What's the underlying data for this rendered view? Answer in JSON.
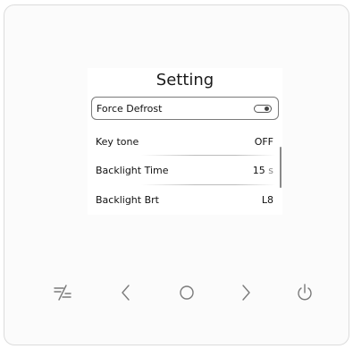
{
  "screen": {
    "title": "Setting",
    "items": [
      {
        "label": "Force Defrost",
        "control": "toggle",
        "state": "on",
        "selected": true
      },
      {
        "label": "Key tone",
        "value": "OFF"
      },
      {
        "label": "Backlight Time",
        "value": "15",
        "unit": "s"
      },
      {
        "label": "Backlight Brt",
        "value": "L8"
      }
    ]
  },
  "buttons": [
    {
      "name": "mode-button",
      "icon": "mode-slash-icon"
    },
    {
      "name": "left-button",
      "icon": "chevron-left-icon"
    },
    {
      "name": "home-button",
      "icon": "circle-icon"
    },
    {
      "name": "right-button",
      "icon": "chevron-right-icon"
    },
    {
      "name": "power-button",
      "icon": "power-icon"
    }
  ],
  "colors": {
    "panel_border": "#dcdcdc",
    "icon": "#7a7a7a",
    "text": "#111111"
  }
}
